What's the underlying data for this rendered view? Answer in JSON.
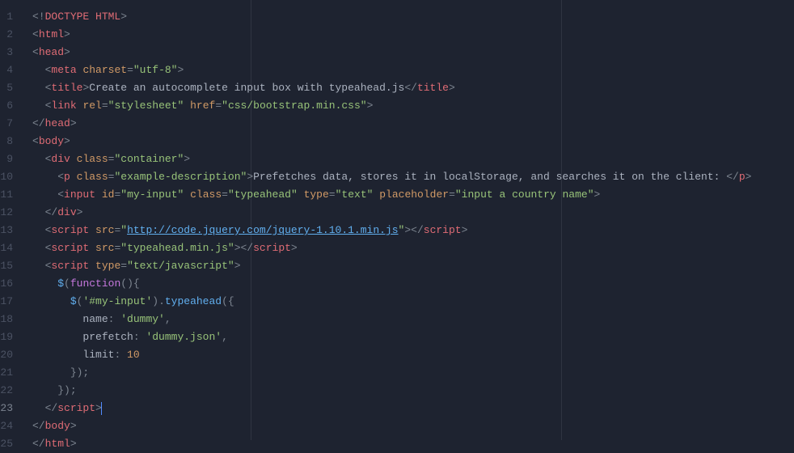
{
  "lineCount": 25,
  "activeLine": 23,
  "rulers": [
    270,
    654
  ],
  "tokens": [
    [
      [
        "i",
        0
      ],
      [
        "p",
        "<!"
      ],
      [
        "t",
        "DOCTYPE HTML"
      ],
      [
        "p",
        ">"
      ]
    ],
    [
      [
        "i",
        0
      ],
      [
        "p",
        "<"
      ],
      [
        "t",
        "html"
      ],
      [
        "p",
        ">"
      ]
    ],
    [
      [
        "i",
        0
      ],
      [
        "p",
        "<"
      ],
      [
        "t",
        "head"
      ],
      [
        "p",
        ">"
      ]
    ],
    [
      [
        "i",
        1
      ],
      [
        "p",
        "<"
      ],
      [
        "t",
        "meta"
      ],
      [
        "x",
        " "
      ],
      [
        "a",
        "charset"
      ],
      [
        "p",
        "="
      ],
      [
        "s",
        "\"utf-8\""
      ],
      [
        "p",
        ">"
      ]
    ],
    [
      [
        "i",
        1
      ],
      [
        "p",
        "<"
      ],
      [
        "t",
        "title"
      ],
      [
        "p",
        ">"
      ],
      [
        "x",
        "Create an autocomplete input box with typeahead.js"
      ],
      [
        "p",
        "</"
      ],
      [
        "t",
        "title"
      ],
      [
        "p",
        ">"
      ]
    ],
    [
      [
        "i",
        1
      ],
      [
        "p",
        "<"
      ],
      [
        "t",
        "link"
      ],
      [
        "x",
        " "
      ],
      [
        "a",
        "rel"
      ],
      [
        "p",
        "="
      ],
      [
        "s",
        "\"stylesheet\""
      ],
      [
        "x",
        " "
      ],
      [
        "a",
        "href"
      ],
      [
        "p",
        "="
      ],
      [
        "s",
        "\"css/bootstrap.min.css\""
      ],
      [
        "p",
        ">"
      ]
    ],
    [
      [
        "i",
        0
      ],
      [
        "p",
        "</"
      ],
      [
        "t",
        "head"
      ],
      [
        "p",
        ">"
      ]
    ],
    [
      [
        "i",
        0
      ],
      [
        "p",
        "<"
      ],
      [
        "t",
        "body"
      ],
      [
        "p",
        ">"
      ]
    ],
    [
      [
        "i",
        1
      ],
      [
        "p",
        "<"
      ],
      [
        "t",
        "div"
      ],
      [
        "x",
        " "
      ],
      [
        "a",
        "class"
      ],
      [
        "p",
        "="
      ],
      [
        "s",
        "\"container\""
      ],
      [
        "p",
        ">"
      ]
    ],
    [
      [
        "i",
        2
      ],
      [
        "p",
        "<"
      ],
      [
        "t",
        "p"
      ],
      [
        "x",
        " "
      ],
      [
        "a",
        "class"
      ],
      [
        "p",
        "="
      ],
      [
        "s",
        "\"example-description\""
      ],
      [
        "p",
        ">"
      ],
      [
        "x",
        "Prefetches data, stores it in localStorage, and searches it on the client: "
      ],
      [
        "p",
        "</"
      ],
      [
        "t",
        "p"
      ],
      [
        "p",
        ">"
      ]
    ],
    [
      [
        "i",
        2
      ],
      [
        "p",
        "<"
      ],
      [
        "t",
        "input"
      ],
      [
        "x",
        " "
      ],
      [
        "a",
        "id"
      ],
      [
        "p",
        "="
      ],
      [
        "s",
        "\"my-input\""
      ],
      [
        "x",
        " "
      ],
      [
        "a",
        "class"
      ],
      [
        "p",
        "="
      ],
      [
        "s",
        "\"typeahead\""
      ],
      [
        "x",
        " "
      ],
      [
        "a",
        "type"
      ],
      [
        "p",
        "="
      ],
      [
        "s",
        "\"text\""
      ],
      [
        "x",
        " "
      ],
      [
        "a",
        "placeholder"
      ],
      [
        "p",
        "="
      ],
      [
        "s",
        "\"input a country name\""
      ],
      [
        "p",
        ">"
      ]
    ],
    [
      [
        "i",
        1
      ],
      [
        "p",
        "</"
      ],
      [
        "t",
        "div"
      ],
      [
        "p",
        ">"
      ]
    ],
    [
      [
        "i",
        1
      ],
      [
        "p",
        "<"
      ],
      [
        "t",
        "script"
      ],
      [
        "x",
        " "
      ],
      [
        "a",
        "src"
      ],
      [
        "p",
        "="
      ],
      [
        "s",
        "\""
      ],
      [
        "l",
        "http://code.jquery.com/jquery-1.10.1.min.js"
      ],
      [
        "s",
        "\""
      ],
      [
        "p",
        "></"
      ],
      [
        "t",
        "script"
      ],
      [
        "p",
        ">"
      ]
    ],
    [
      [
        "i",
        1
      ],
      [
        "p",
        "<"
      ],
      [
        "t",
        "script"
      ],
      [
        "x",
        " "
      ],
      [
        "a",
        "src"
      ],
      [
        "p",
        "="
      ],
      [
        "s",
        "\"typeahead.min.js\""
      ],
      [
        "p",
        "></"
      ],
      [
        "t",
        "script"
      ],
      [
        "p",
        ">"
      ]
    ],
    [
      [
        "i",
        1
      ],
      [
        "p",
        "<"
      ],
      [
        "t",
        "script"
      ],
      [
        "x",
        " "
      ],
      [
        "a",
        "type"
      ],
      [
        "p",
        "="
      ],
      [
        "s",
        "\"text/javascript\""
      ],
      [
        "p",
        ">"
      ]
    ],
    [
      [
        "i",
        2
      ],
      [
        "f",
        "$"
      ],
      [
        "p",
        "("
      ],
      [
        "k",
        "function"
      ],
      [
        "p",
        "(){"
      ]
    ],
    [
      [
        "i",
        3
      ],
      [
        "f",
        "$"
      ],
      [
        "p",
        "("
      ],
      [
        "s",
        "'#my-input'"
      ],
      [
        "p",
        ")."
      ],
      [
        "f",
        "typeahead"
      ],
      [
        "p",
        "({"
      ]
    ],
    [
      [
        "i",
        4
      ],
      [
        "pr",
        "name"
      ],
      [
        "p",
        ": "
      ],
      [
        "s",
        "'dummy'"
      ],
      [
        "p",
        ","
      ]
    ],
    [
      [
        "i",
        4
      ],
      [
        "pr",
        "prefetch"
      ],
      [
        "p",
        ": "
      ],
      [
        "s",
        "'dummy.json'"
      ],
      [
        "p",
        ","
      ]
    ],
    [
      [
        "i",
        4
      ],
      [
        "pr",
        "limit"
      ],
      [
        "p",
        ": "
      ],
      [
        "n",
        "10"
      ]
    ],
    [
      [
        "i",
        3
      ],
      [
        "p",
        "});"
      ]
    ],
    [
      [
        "i",
        2
      ],
      [
        "p",
        "});"
      ]
    ],
    [
      [
        "i",
        1
      ],
      [
        "p",
        "</"
      ],
      [
        "t",
        "script"
      ],
      [
        "p",
        ">"
      ],
      [
        "cur",
        ""
      ]
    ],
    [
      [
        "i",
        0
      ],
      [
        "p",
        "</"
      ],
      [
        "t",
        "body"
      ],
      [
        "p",
        ">"
      ]
    ],
    [
      [
        "i",
        0
      ],
      [
        "p",
        "</"
      ],
      [
        "t",
        "html"
      ],
      [
        "p",
        ">"
      ]
    ]
  ]
}
